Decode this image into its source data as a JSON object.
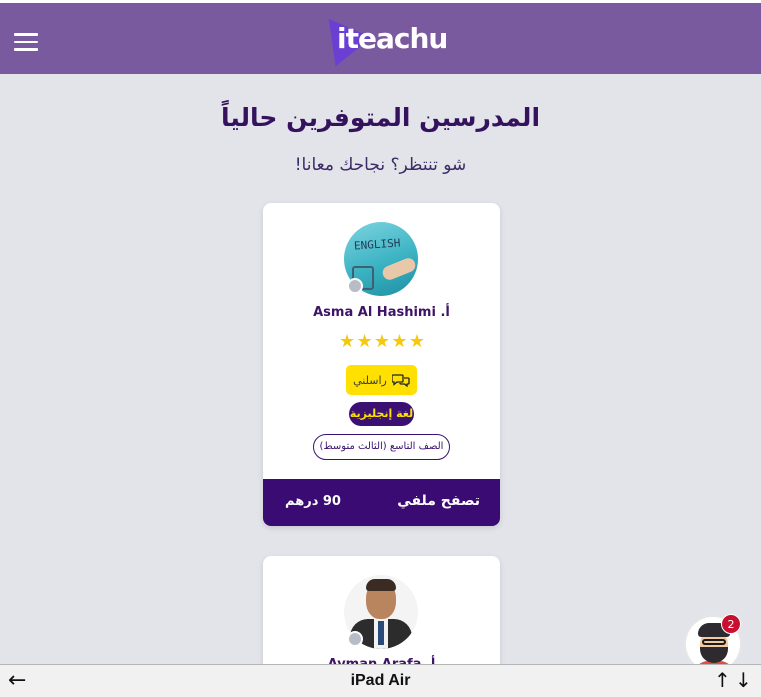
{
  "header": {
    "logo_text": "iteachu",
    "menu_icon": "hamburger-menu-icon",
    "background_color": "#7a5a9e"
  },
  "main": {
    "title": "المدرسين المتوفرين حالياً",
    "subtitle": "شو تنتظر؟ نجاحك معانا!"
  },
  "teachers": [
    {
      "name": "Asma Al Hashimi  .أ",
      "rating": 5,
      "rating_max": 5,
      "message_label": "راسلني",
      "subject": "لغة إنجليزية",
      "grade": "الصف التاسع (الثالث متوسط)",
      "price": "90 درهم",
      "profile_label": "تصفح ملفي",
      "avatar_text": "ENGLISH",
      "online": false
    },
    {
      "name": "Ayman Arafa  .أ",
      "online": false
    }
  ],
  "chat_widget": {
    "notification_count": "2",
    "icon": "support-avatar-icon"
  },
  "device_bar": {
    "device_name": "iPad Air",
    "left_arrow": "←",
    "up_arrow": "↑",
    "down_arrow": "↓"
  },
  "colors": {
    "accent": "#3a0b72",
    "button_yellow": "#ffe000",
    "star": "#f6c90e",
    "page_bg": "#e2e4ea"
  }
}
